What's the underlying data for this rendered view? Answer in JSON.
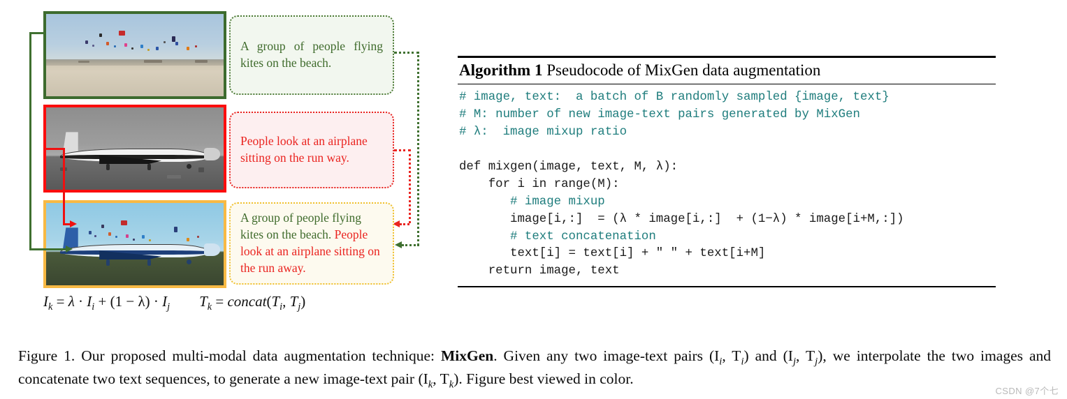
{
  "figure": {
    "images": [
      {
        "name": "kites-on-beach",
        "border_color": "#3d6b2e",
        "alt": "A group of people flying kites on the beach"
      },
      {
        "name": "airplane-on-runway",
        "border_color": "#fb0d0d",
        "alt": "Black and white airplane sitting on the run way"
      },
      {
        "name": "mixed-image",
        "border_color": "#f7b944",
        "alt": "Blended image of kites and airplane"
      }
    ],
    "captions": {
      "green": "A group of people flying kites on the beach.",
      "red": "People look at an airplane sitting on the run way.",
      "mixed_part_green": "A group of people flying kites on the beach. ",
      "mixed_part_red": "People look at an airplane sitting on the run away."
    },
    "equations": {
      "image_mix": "I_k = λ · I_i + (1 − λ) · I_j",
      "text_concat": "T_k = concat(T_i, T_j)"
    }
  },
  "algorithm": {
    "title_bold": "Algorithm 1",
    "title_rest": " Pseudocode of MixGen data augmentation",
    "lines": [
      {
        "type": "comment",
        "text": "# image, text:  a batch of B randomly sampled {image, text}"
      },
      {
        "type": "comment",
        "text": "# M: number of new image-text pairs generated by MixGen"
      },
      {
        "type": "comment",
        "text": "# λ:  image mixup ratio"
      },
      {
        "type": "blank",
        "text": ""
      },
      {
        "type": "code",
        "text": "def mixgen(image, text, M, λ):"
      },
      {
        "type": "code",
        "text": "    for i in range(M):"
      },
      {
        "type": "comment",
        "text": "       # image mixup"
      },
      {
        "type": "code",
        "text": "       image[i,:]  = (λ * image[i,:]  + (1−λ) * image[i+M,:])"
      },
      {
        "type": "comment",
        "text": "       # text concatenation"
      },
      {
        "type": "code",
        "text": "       text[i] = text[i] + \" \" + text[i+M]"
      },
      {
        "type": "code",
        "text": "    return image, text"
      }
    ],
    "comment_color": "#1f7d7d"
  },
  "caption": {
    "line1_pre": "Figure 1. Our proposed multi-modal data augmentation technique: ",
    "method_name": "MixGen",
    "line1_post": ". Given any two image-text pairs (I",
    "pair1_sub1": "i",
    "pair1_mid": ", T",
    "pair1_sub2": "i",
    "pair1_end": ") and (I",
    "pair2_sub1": "j",
    "pair2_mid": ", T",
    "pair2_sub2": "j",
    "pair2_end": "), we",
    "line2_pre": "interpolate the two images and concatenate two text sequences, to generate a new image-text pair (I",
    "pair3_sub1": "k",
    "pair3_mid": ", T",
    "pair3_sub2": "k",
    "pair3_end": "). Figure best viewed in color."
  },
  "watermark": {
    "text": "CSDN @7个七"
  }
}
